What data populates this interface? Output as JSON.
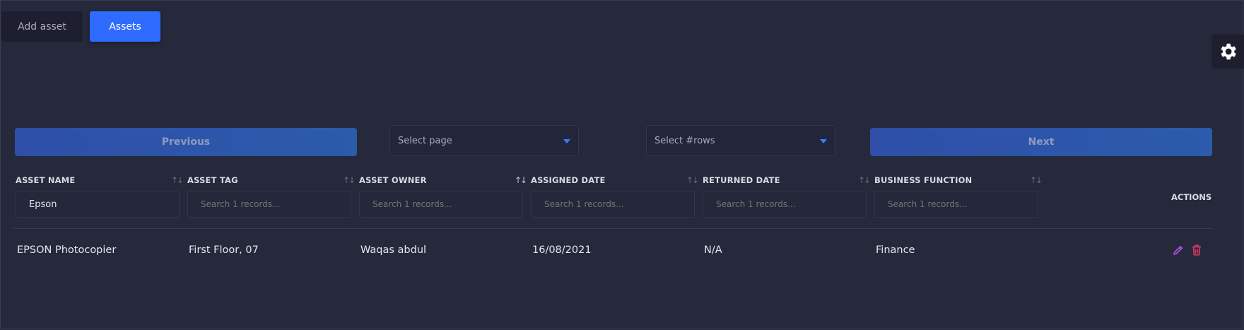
{
  "top_tabs": {
    "add_asset": "Add asset",
    "assets": "Assets"
  },
  "pagination": {
    "previous": "Previous",
    "next": "Next",
    "select_page_placeholder": "Select page",
    "select_rows_placeholder": "Select #rows"
  },
  "table": {
    "columns": [
      "ASSET NAME",
      "ASSET TAG",
      "ASSET OWNER",
      "ASSIGNED DATE",
      "RETURNED DATE",
      "BUSINESS FUNCTION"
    ],
    "actions_header": "ACTIONS",
    "filters": {
      "asset_name_value": "Epson",
      "placeholder": "Search 1 records..."
    },
    "rows": [
      [
        "EPSON Photocopier",
        "First Floor, 07",
        "Waqas abdul",
        "16/08/2021",
        "N/A",
        "Finance"
      ]
    ]
  },
  "colors": {
    "background": "#26283b",
    "accent": "#2f6bff",
    "edit_icon": "#b44ee8",
    "delete_icon": "#e83a6a"
  },
  "icons": {
    "settings": "gear-icon",
    "edit": "pencil-icon",
    "delete": "trash-icon"
  }
}
